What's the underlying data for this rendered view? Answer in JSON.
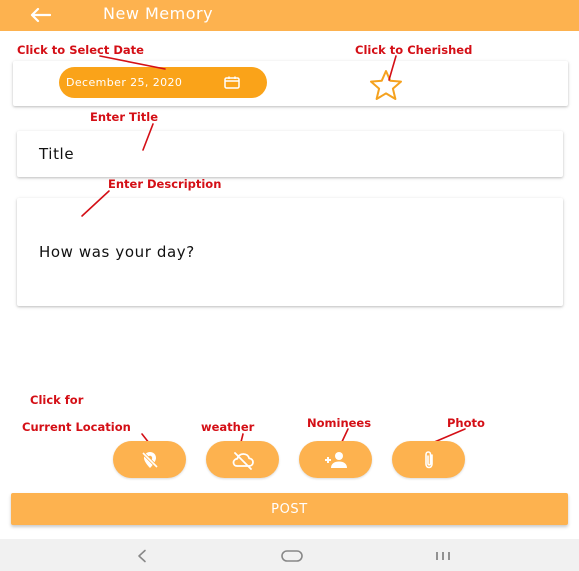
{
  "app_bar": {
    "title": "New Memory",
    "back_icon": "arrow-left-icon",
    "background": "#FDB24F"
  },
  "date_card": {
    "date_value": "December 25, 2020",
    "calendar_icon": "calendar-icon",
    "favorite_icon": "star-outline-icon",
    "pill_color": "#FAA319"
  },
  "title_field": {
    "value": "Title"
  },
  "description_field": {
    "value": "How was your day?"
  },
  "annotations": {
    "select_date": "Click to Select Date",
    "cherished": "Click to Cherished",
    "enter_title": "Enter Title",
    "enter_description": "Enter Description",
    "click_for": "Click for",
    "current_location": "Current Location",
    "weather": "weather",
    "nominees": "Nominees",
    "photo": "Photo",
    "color": "#D40F16"
  },
  "action_buttons": [
    {
      "icon": "location-off-icon"
    },
    {
      "icon": "cloud-off-icon"
    },
    {
      "icon": "add-person-icon"
    },
    {
      "icon": "paperclip-icon"
    }
  ],
  "post_button": {
    "label": "POST"
  },
  "system_nav": {
    "back": "nav-back-icon",
    "home": "nav-home-icon",
    "recents": "nav-recents-icon"
  }
}
